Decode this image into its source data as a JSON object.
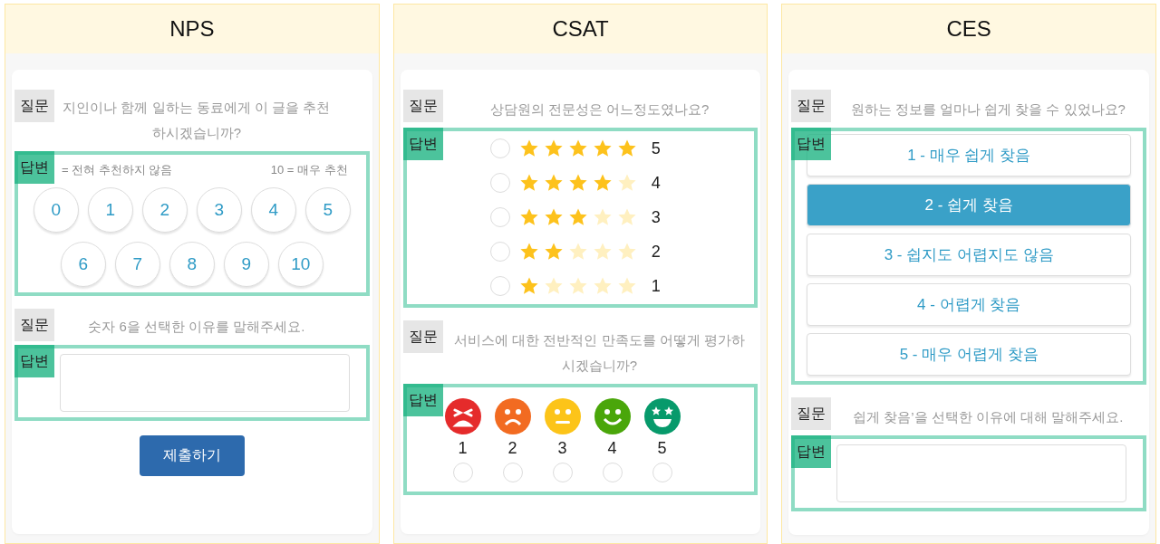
{
  "panels": [
    {
      "title": "NPS",
      "items": [
        {
          "kind": "question",
          "tag": "질문",
          "text": "지인이나 함께 일하는 동료에게 이 글을 추천하시겠습니까?"
        },
        {
          "kind": "nps",
          "tag": "답변",
          "low_label": "= 전혀 추천하지 않음",
          "high_label": "10 = 매우 추천",
          "options": [
            {
              "label": "0",
              "selected": false
            },
            {
              "label": "1",
              "selected": false
            },
            {
              "label": "2",
              "selected": false
            },
            {
              "label": "3",
              "selected": false
            },
            {
              "label": "4",
              "selected": false
            },
            {
              "label": "5",
              "selected": false
            },
            {
              "label": "6",
              "selected": false
            },
            {
              "label": "7",
              "selected": false
            },
            {
              "label": "8",
              "selected": false
            },
            {
              "label": "9",
              "selected": false
            },
            {
              "label": "10",
              "selected": false
            }
          ]
        },
        {
          "kind": "question",
          "tag": "질문",
          "text": "숫자 6을 선택한 이유를 말해주세요."
        },
        {
          "kind": "text_answer",
          "tag": "답변"
        },
        {
          "kind": "submit",
          "label": "제출하기"
        }
      ]
    },
    {
      "title": "CSAT",
      "items": [
        {
          "kind": "question",
          "tag": "질문",
          "text": "상담원의 전문성은 어느정도였나요?"
        },
        {
          "kind": "stars",
          "tag": "답변",
          "options": [
            {
              "stars": 5,
              "label": "5",
              "selected": false
            },
            {
              "stars": 4,
              "label": "4",
              "selected": false
            },
            {
              "stars": 3,
              "label": "3",
              "selected": false
            },
            {
              "stars": 2,
              "label": "2",
              "selected": false
            },
            {
              "stars": 1,
              "label": "1",
              "selected": false
            }
          ]
        },
        {
          "kind": "question",
          "tag": "질문",
          "text": "서비스에 대한 전반적인 만족도를 어떻게 평가하시겠습니까?"
        },
        {
          "kind": "faces",
          "tag": "답변",
          "options": [
            {
              "kind": "angry",
              "color": "#e52b2b",
              "label": "1",
              "selected": false
            },
            {
              "kind": "sad",
              "color": "#f26b21",
              "label": "2",
              "selected": false
            },
            {
              "kind": "neutral",
              "color": "#fcc419",
              "label": "3",
              "selected": false
            },
            {
              "kind": "happy",
              "color": "#4aa60a",
              "label": "4",
              "selected": false
            },
            {
              "kind": "starry",
              "color": "#079a6b",
              "label": "5",
              "selected": false
            }
          ]
        }
      ]
    },
    {
      "title": "CES",
      "items": [
        {
          "kind": "question",
          "tag": "질문",
          "text": "원하는 정보를 얼마나 쉽게 찾을 수 있었나요?"
        },
        {
          "kind": "choices",
          "tag": "답변",
          "options": [
            {
              "label": "1 - 매우 쉽게 찾음",
              "selected": false
            },
            {
              "label": "2 - 쉽게 찾음",
              "selected": true
            },
            {
              "label": "3 - 쉽지도 어렵지도 않음",
              "selected": false
            },
            {
              "label": "4 - 어렵게 찾음",
              "selected": false
            },
            {
              "label": "5 - 매우 어렵게 찾음",
              "selected": false
            }
          ]
        },
        {
          "kind": "question",
          "tag": "질문",
          "text": "쉽게 찾음’을 선택한 이유에 대해 말해주세요."
        },
        {
          "kind": "text_answer",
          "tag": "답변"
        }
      ]
    }
  ]
}
